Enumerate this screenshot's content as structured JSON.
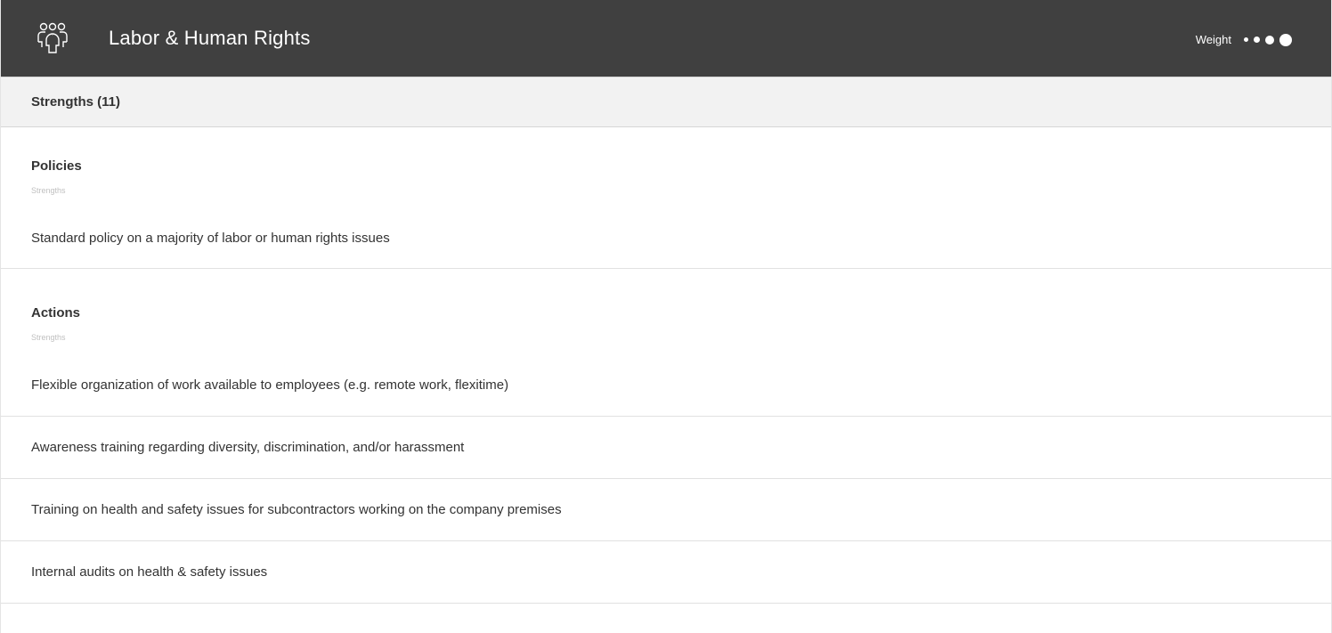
{
  "header": {
    "title": "Labor & Human Rights",
    "icon": "people-group-icon",
    "weight_label": "Weight",
    "weight_level": 4,
    "weight_max": 4
  },
  "section": {
    "label": "Strengths (11)"
  },
  "groups": [
    {
      "title": "Policies",
      "subtitle": "Strengths",
      "items": [
        "Standard policy on a majority of labor or human rights issues"
      ]
    },
    {
      "title": "Actions",
      "subtitle": "Strengths",
      "items": [
        "Flexible organization of work available to employees (e.g. remote work, flexitime)",
        "Awareness training regarding diversity, discrimination, and/or harassment",
        "Training on health and safety issues for subcontractors working on the company premises",
        "Internal audits on health & safety issues"
      ]
    }
  ],
  "colors": {
    "header_bg": "#404040",
    "section_bg": "#f2f2f2",
    "text": "#333333",
    "muted": "#c0c0c0"
  }
}
